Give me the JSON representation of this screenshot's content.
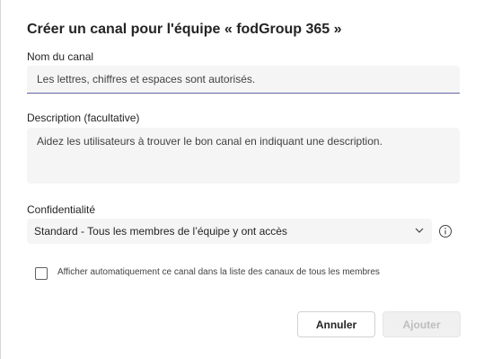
{
  "dialog": {
    "title": "Créer un canal pour l'équipe « fodGroup 365 »"
  },
  "name_field": {
    "label": "Nom du canal",
    "placeholder": "Les lettres, chiffres et espaces sont autorisés."
  },
  "description_field": {
    "label": "Description (facultative)",
    "placeholder": "Aidez les utilisateurs à trouver le bon canal en indiquant une description."
  },
  "privacy": {
    "label": "Confidentialité",
    "selected": "Standard - Tous les membres de l’équipe y ont accès",
    "info_icon": "info-icon",
    "chevron_icon": "chevron-down-icon"
  },
  "show_channel": {
    "checked": false,
    "label": "Afficher automatiquement ce canal dans la liste des canaux de tous les membres"
  },
  "buttons": {
    "cancel": "Annuler",
    "add": "Ajouter"
  },
  "colors": {
    "accent_underline": "#6264a7",
    "field_background": "#f5f5f5",
    "disabled_text": "#bdbdbd"
  }
}
